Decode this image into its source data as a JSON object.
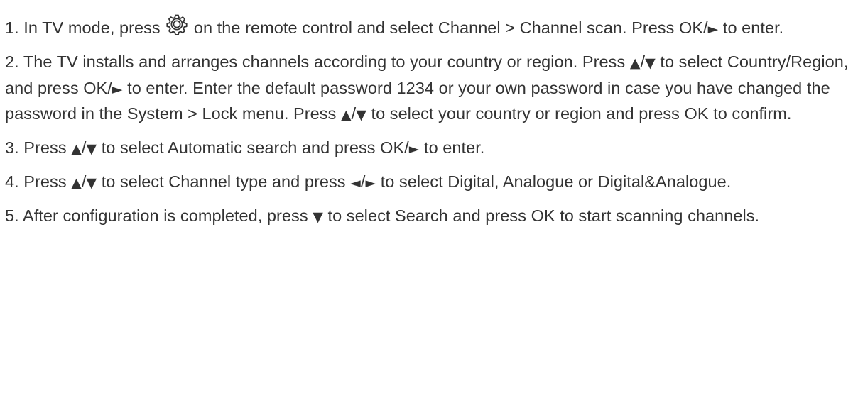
{
  "steps": [
    {
      "number": "1.",
      "parts": {
        "a": "In TV mode, press",
        "icon": "gear-icon",
        "b": "on the remote control and select Channel > Channel scan. Press OK/",
        "right1": "►",
        "c": " to enter."
      }
    },
    {
      "number": "2.",
      "parts": {
        "a": "The TV installs and arranges channels according to your country or region. Press ",
        "up1": "▲",
        "slash1": "/",
        "down1": "▼",
        "b": " to select Country/Region, and press OK/",
        "right1": "►",
        "c": " to enter. Enter the default password 1234 or your own password in case you have changed the password in the System > Lock menu. Press ",
        "up2": "▲",
        "slash2": "/",
        "down2": "▼",
        "d": " to select your country or region and press OK to confirm."
      }
    },
    {
      "number": "3.",
      "parts": {
        "a": "Press ",
        "up1": "▲",
        "slash1": "/",
        "down1": "▼",
        "b": " to select Automatic search and press OK/",
        "right1": "►",
        "c": " to enter."
      }
    },
    {
      "number": "4.",
      "parts": {
        "a": "Press ",
        "up1": "▲",
        "slash1": "/",
        "down1": "▼",
        "b": " to select Channel type and press ",
        "left1": "◄",
        "slash2": "/",
        "right1": "►",
        "c": " to select Digital, Analogue or Digital&Analogue."
      }
    },
    {
      "number": "5.",
      "parts": {
        "a": "After configuration is completed, press ",
        "down1": "▼",
        "b": " to select Search and press OK to start scanning channels."
      }
    }
  ],
  "colors": {
    "text": "#333333",
    "background": "#ffffff"
  }
}
